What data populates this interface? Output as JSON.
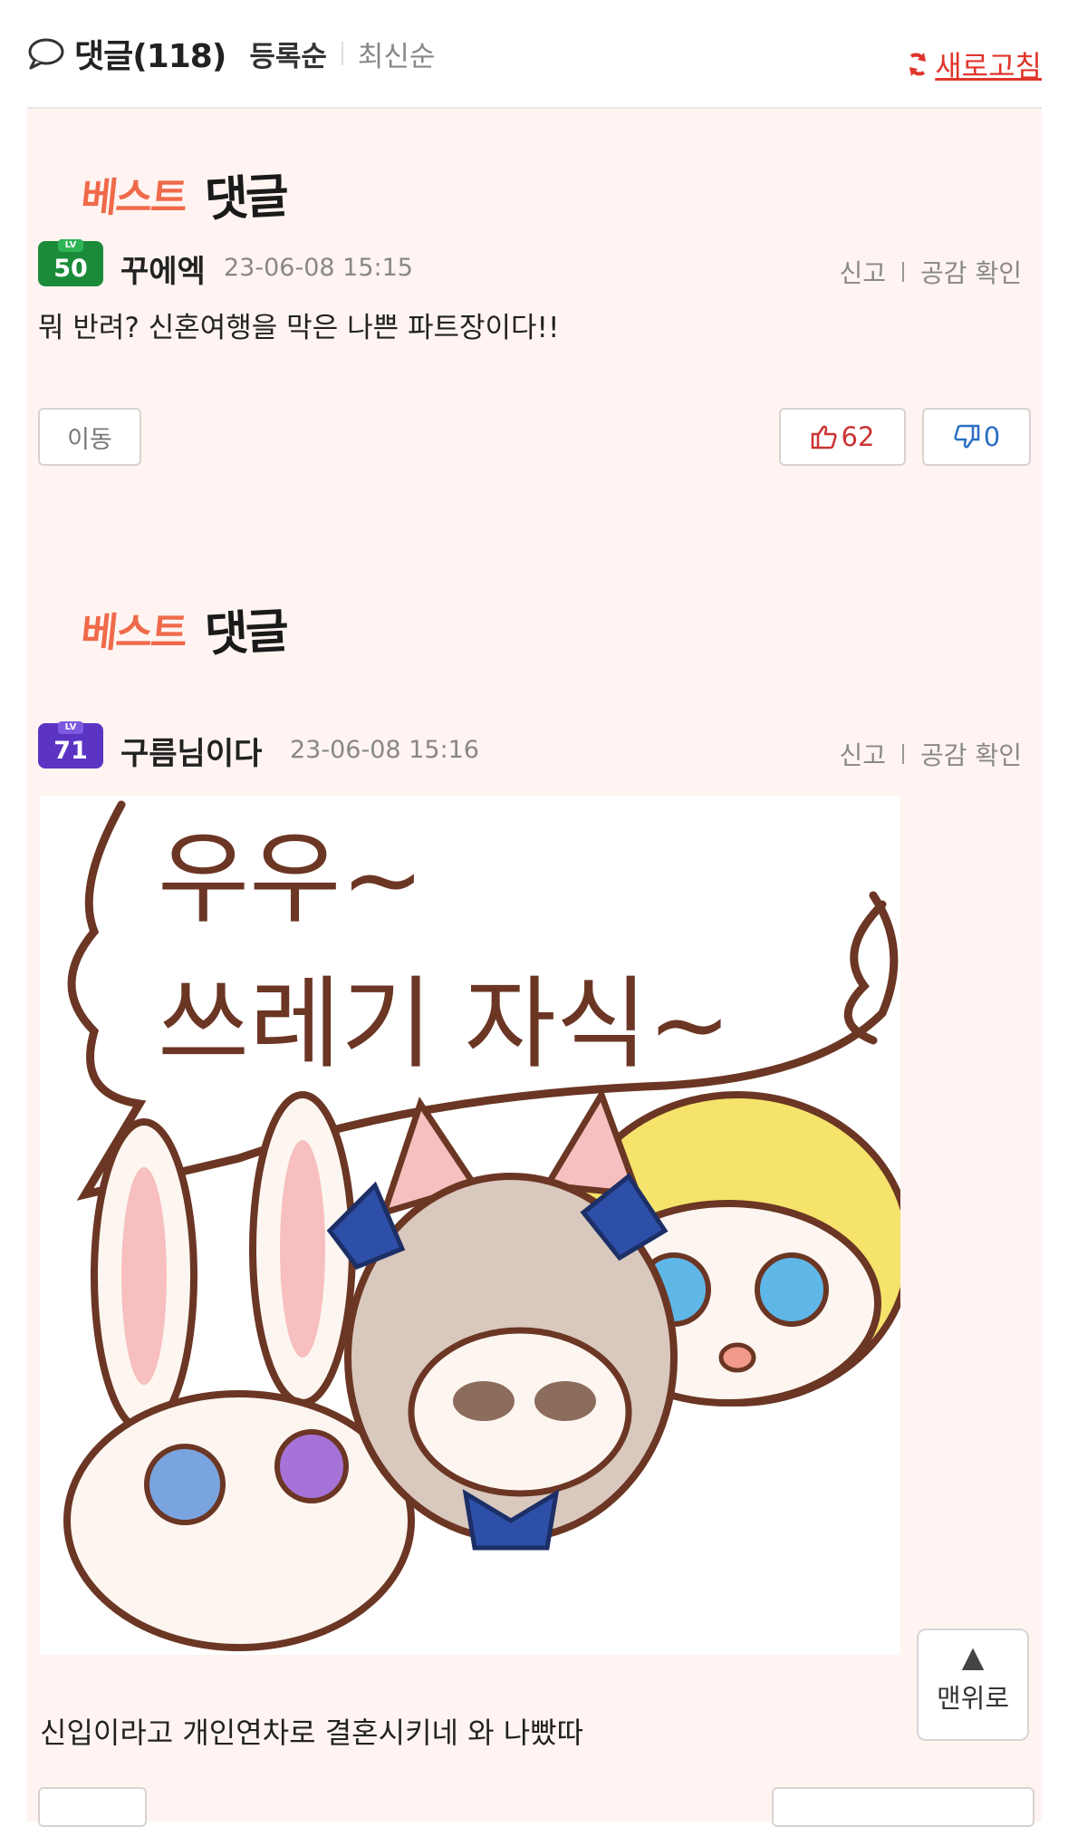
{
  "header": {
    "comments_label": "댓글",
    "comments_count": "(118)",
    "sort_primary": "등록순",
    "sort_secondary": "최신순",
    "refresh_label": "새로고침"
  },
  "best_badge": {
    "part1": "베스트",
    "part2": "댓글"
  },
  "comments": [
    {
      "level": "50",
      "level_tag": "LV",
      "username": "꾸에엑",
      "date": "23-06-08 15:15",
      "report_label": "신고",
      "empathy_label": "공감 확인",
      "text": "뭐 반려? 신혼여행을 막은 나쁜 파트장이다!!",
      "move_label": "이동",
      "likes": "62",
      "dislikes": "0"
    },
    {
      "level": "71",
      "level_tag": "LV",
      "username": "구름님이다",
      "date": "23-06-08 15:16",
      "report_label": "신고",
      "empathy_label": "공감 확인",
      "sticker_text_line1": "우우~",
      "sticker_text_line2": "쓰레기 자식~",
      "text": "신입이라고 개인연차로 결혼시키네 와 나빴따"
    }
  ],
  "scroll_top": {
    "arrow": "▲",
    "label": "맨위로"
  },
  "colors": {
    "accent": "#e0352b",
    "card_bg": "#fff4f1",
    "like": "#cc3333",
    "dislike": "#2a6fc4"
  }
}
